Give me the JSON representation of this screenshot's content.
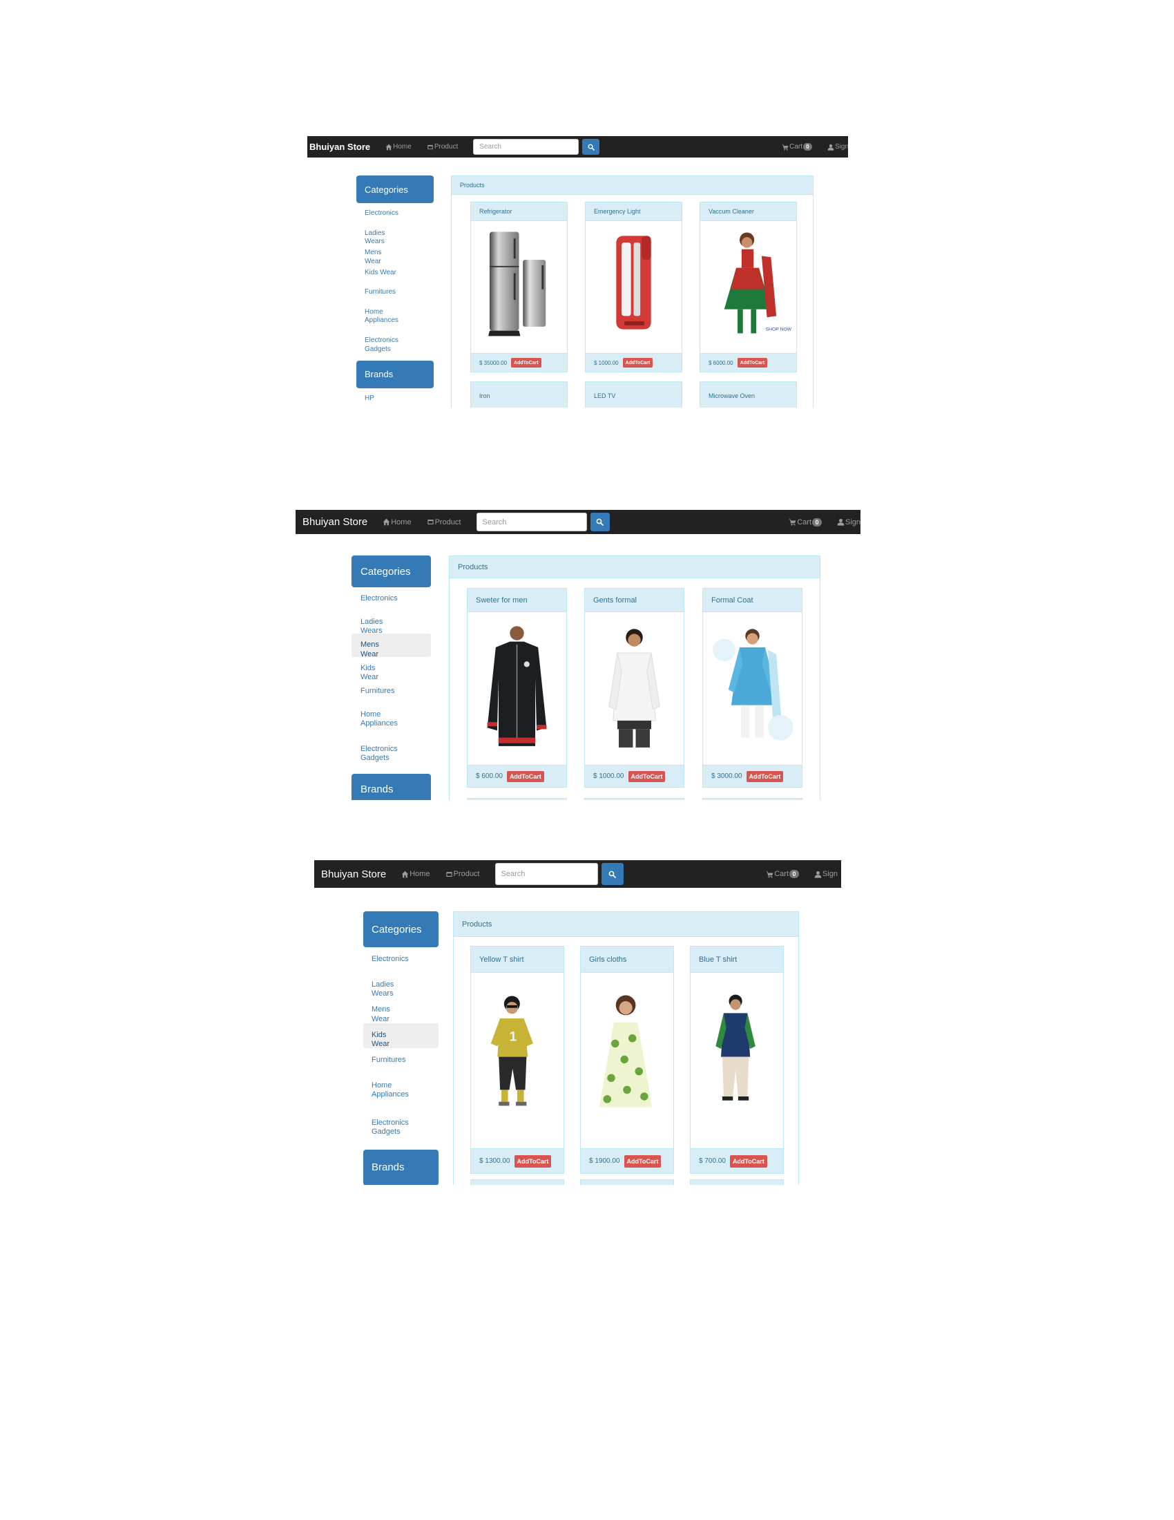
{
  "navbar": {
    "brand": "Bhuiyan Store",
    "home_label": "Home",
    "product_label": "Product",
    "search_placeholder": "Search",
    "cart_label": "Cart",
    "cart_count": "0",
    "signin_label": "Sign"
  },
  "sidebar": {
    "categories_heading": "Categories",
    "brands_heading": "Brands",
    "categories": [
      {
        "label": "Electronics"
      },
      {
        "label": "Ladies Wears"
      },
      {
        "label": "Mens Wear"
      },
      {
        "label": "Kids Wear"
      },
      {
        "label": "Furnitures"
      },
      {
        "label": "Home Appliances"
      },
      {
        "label": "Electronics Gadgets"
      }
    ],
    "brands": [
      {
        "label": "HP"
      }
    ]
  },
  "products_heading": "Products",
  "add_to_cart_label": "AddToCart",
  "screens": [
    {
      "active_category": "",
      "products": [
        {
          "title": "Refrigerator",
          "price": "$ 35000.00",
          "image": "refrigerator"
        },
        {
          "title": "Emergency Light",
          "price": "$ 1000.00",
          "image": "emergency-light"
        },
        {
          "title": "Vaccum Cleaner",
          "price": "$ 6000.00",
          "image": "girl-dress-red"
        }
      ],
      "next_row": [
        {
          "title": "Iron"
        },
        {
          "title": "LED TV"
        },
        {
          "title": "Microwave Oven"
        }
      ]
    },
    {
      "active_category": "Mens Wear",
      "products": [
        {
          "title": "Sweter for men",
          "price": "$ 600.00",
          "image": "black-sweater"
        },
        {
          "title": "Gents formal",
          "price": "$ 1000.00",
          "image": "man-white-shirt"
        },
        {
          "title": "Formal Coat",
          "price": "$ 3000.00",
          "image": "boy-blue-sherwani"
        }
      ]
    },
    {
      "active_category": "Kids Wear",
      "products": [
        {
          "title": "Yellow T shirt",
          "price": "$ 1300.00",
          "image": "boy-yellow-tshirt"
        },
        {
          "title": "Girls cloths",
          "price": "$ 1900.00",
          "image": "girl-green-dress"
        },
        {
          "title": "Blue T shirt",
          "price": "$ 700.00",
          "image": "boy-blue-vest"
        }
      ]
    }
  ]
}
